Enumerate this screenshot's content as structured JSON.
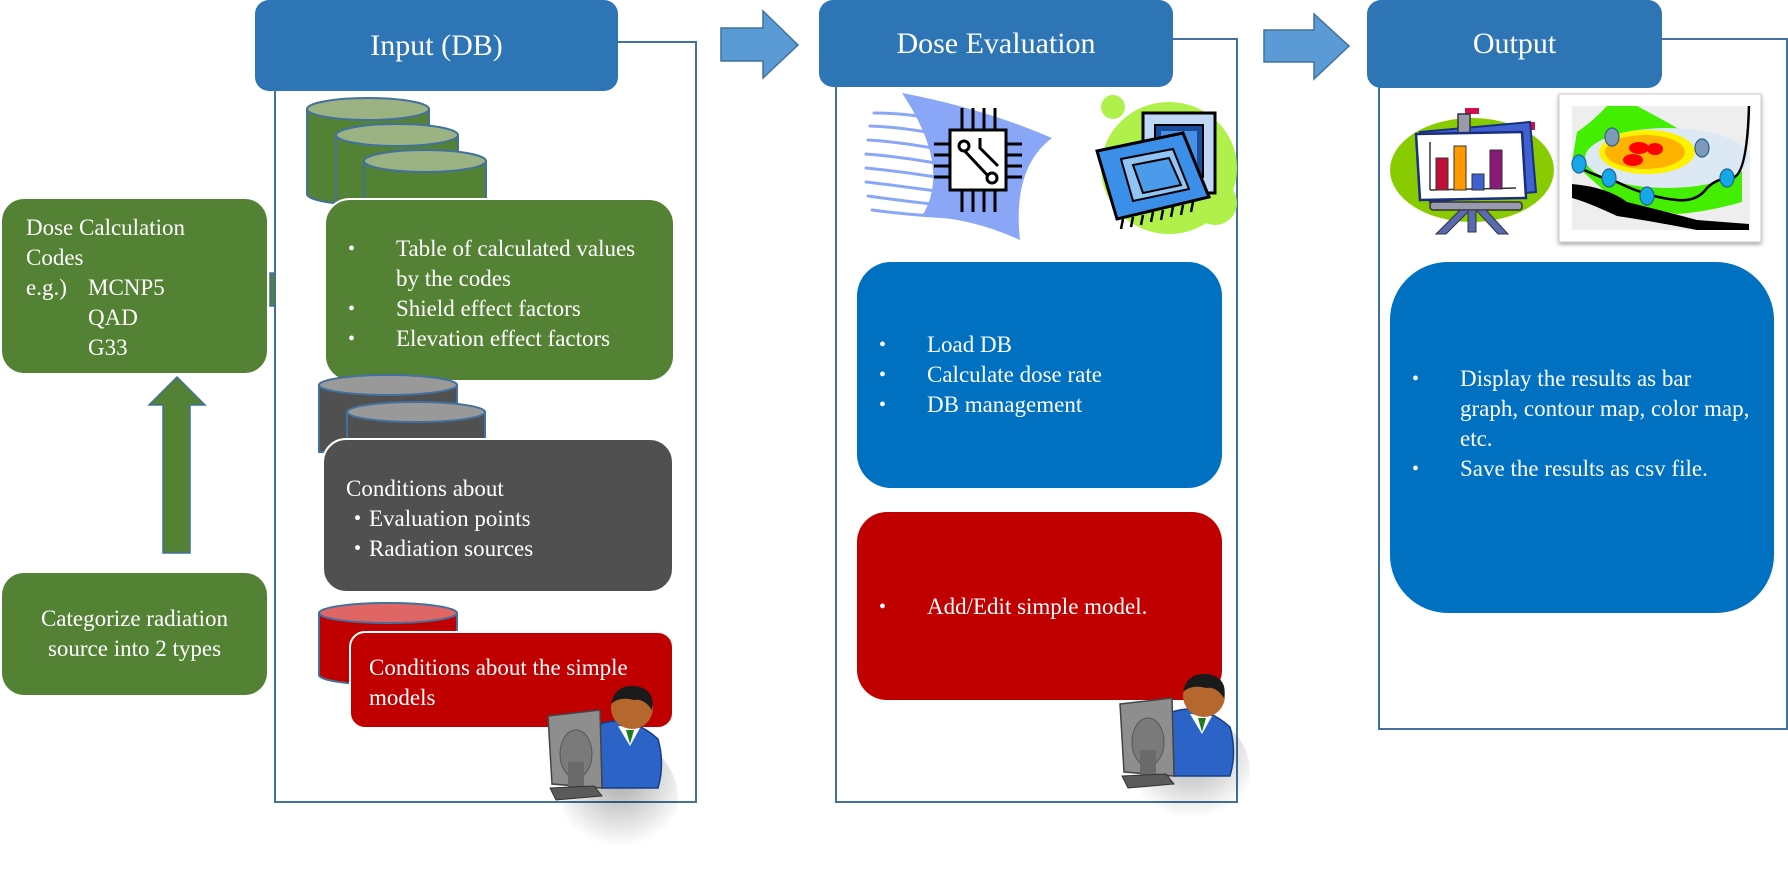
{
  "left_column": {
    "codes_box": {
      "title": "Dose Calculation Codes",
      "line1": "Dose Calculation",
      "line2": "Codes",
      "eg_label": "e.g.)",
      "codes": [
        "MCNP5",
        "QAD",
        "G33"
      ]
    },
    "categorize_box": {
      "lines": [
        "Categorize radiation",
        "source into 2 types"
      ]
    }
  },
  "stages": [
    {
      "title": "Input (DB)",
      "boxes": [
        {
          "color": "#548235",
          "items": [
            "Table of calculated values  by the codes",
            "Shield effect factors",
            "Elevation effect factors"
          ]
        },
        {
          "color": "#505050",
          "heading": "Conditions about",
          "items": [
            "・Evaluation points",
            "・Radiation sources"
          ]
        },
        {
          "color": "#C00000",
          "text": "Conditions about the simple models"
        }
      ]
    },
    {
      "title": "Dose Evaluation",
      "boxes": [
        {
          "color": "#0070C0",
          "items": [
            "Load DB",
            "Calculate dose rate",
            "DB management"
          ]
        },
        {
          "color": "#C00000",
          "items": [
            "Add/Edit simple model."
          ]
        }
      ]
    },
    {
      "title": "Output",
      "boxes": [
        {
          "color": "#0070C0",
          "items": [
            "Display the results as bar graph, contour map, color map, etc.",
            "Save the results as csv file."
          ]
        }
      ]
    }
  ],
  "icons": {
    "database_green": "database-icon",
    "database_gray": "database-icon",
    "database_red": "database-icon",
    "user_at_computer": "user-computer-icon",
    "circuit_chip": "circuit-chip-icon",
    "processor": "processor-icon",
    "bar_chart_easel": "bar-chart-easel-icon",
    "contour_map": "contour-map-icon"
  },
  "colors": {
    "header_blue": "#2E75B6",
    "panel_border": "#41719C",
    "arrow_blue": "#5B9BD5",
    "green": "#548235",
    "gray": "#505050",
    "red": "#C00000",
    "blue": "#0070C0"
  }
}
